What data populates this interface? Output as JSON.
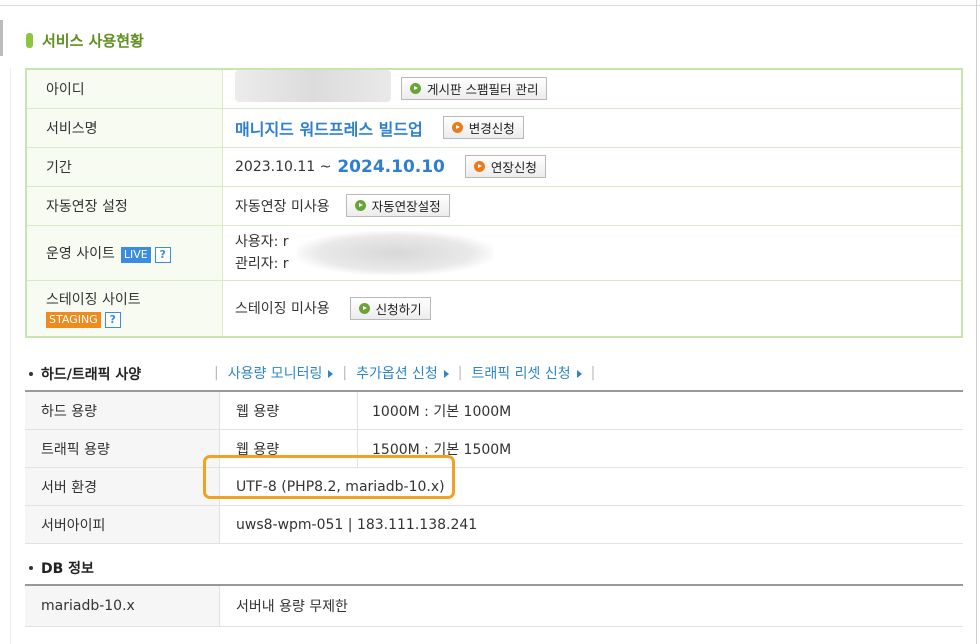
{
  "section_title": "서비스 사용현황",
  "info": {
    "id_label": "아이디",
    "spam_filter_button": "게시판 스팸필터 관리",
    "service_label": "서비스명",
    "service_name": "매니지드 워드프레스 빌드업",
    "change_button": "변경신청",
    "period_label": "기간",
    "period_start": "2023.10.11 ~",
    "period_end": "2024.10.10",
    "extend_button": "연장신청",
    "auto_renew_label": "자동연장 설정",
    "auto_renew_value": "자동연장 미사용",
    "auto_renew_button": "자동연장설정",
    "live_site_label": "운영 사이트",
    "live_badge": "LIVE",
    "help_badge": "?",
    "user_prefix": "사용자: r",
    "admin_prefix": "관리자: r",
    "staging_label": "스테이징 사이트",
    "staging_badge": "STAGING",
    "staging_value": "스테이징 미사용",
    "apply_button": "신청하기"
  },
  "hw": {
    "title": "하드/트래픽 사양",
    "links": [
      "사용량 모니터링",
      "추가옵션 신청",
      "트래픽 리셋 신청"
    ],
    "rows": [
      {
        "label": "하드 용량",
        "type": "웹 용량",
        "value": "1000M : 기본 1000M"
      },
      {
        "label": "트래픽 용량",
        "type": "웹 용량",
        "value": "1500M : 기본 1500M"
      },
      {
        "label": "서버 환경",
        "value": "UTF-8 (PHP8.2, mariadb-10.x)"
      },
      {
        "label": "서버아이피",
        "value": "uws8-wpm-051 | 183.111.138.241"
      }
    ]
  },
  "db": {
    "title": "DB 정보",
    "label": "mariadb-10.x",
    "value": "서버내 용량 무제한"
  },
  "colors": {
    "accent_green": "#8cc63e",
    "link_blue": "#2e86c9",
    "highlight": "#f0a320"
  }
}
